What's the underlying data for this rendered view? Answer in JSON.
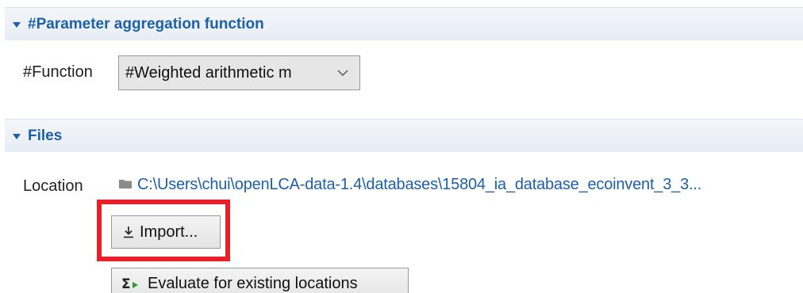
{
  "param_section": {
    "title": "#Parameter aggregation function",
    "function_label": "#Function",
    "function_select_value": "#Weighted arithmetic m"
  },
  "files_section": {
    "title": "Files",
    "location_label": "Location",
    "location_path": "C:\\Users\\chui\\openLCA-data-1.4\\databases\\15804_ia_database_ecoinvent_3_3...",
    "import_button_label": "Import...",
    "evaluate_button_label": "Evaluate for existing locations"
  },
  "colors": {
    "section_title": "#1d5fa8",
    "link": "#1d5fa8",
    "highlight_box": "#e8202a"
  },
  "icons": {
    "import": "download-arrow-icon",
    "evaluate": "sigma-run-icon",
    "folder": "folder-icon"
  }
}
